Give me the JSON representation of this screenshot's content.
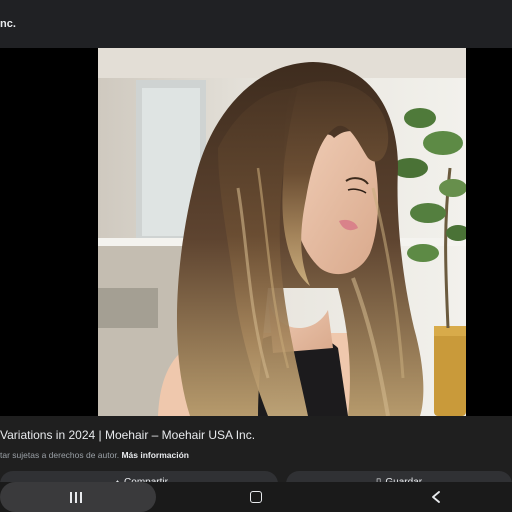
{
  "header": {
    "source_label": "nc."
  },
  "image": {
    "subject": "photo of woman with long layered brown hair with blonde highlights"
  },
  "caption": {
    "title": "Variations in 2024 | Moehair – Moehair USA Inc.",
    "notice": "tar sujetas a derechos de autor.",
    "more_link": "Más información"
  },
  "actions": {
    "share_label": "Compartir",
    "save_label": "Guardar"
  },
  "icons": {
    "share": "share-icon",
    "save": "bookmark-icon",
    "recents": "recents-icon",
    "home": "home-icon",
    "back": "back-icon"
  },
  "colors": {
    "background": "#1f1f1f",
    "text": "#e8eaed",
    "muted_text": "#9aa0a6",
    "button": "#303134"
  }
}
